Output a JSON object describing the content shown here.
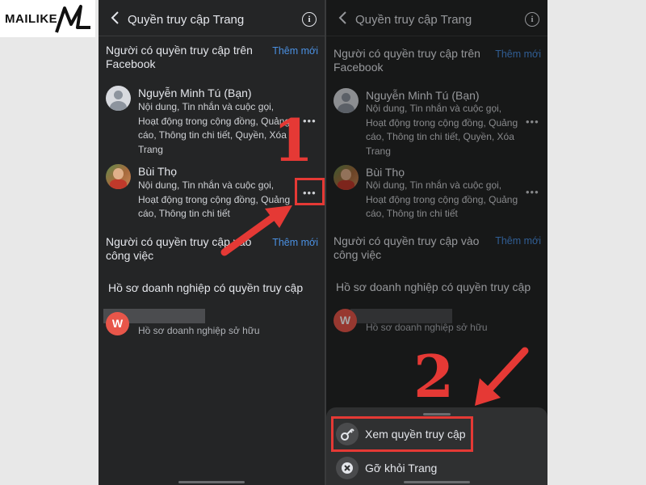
{
  "brand": {
    "text": "MAILIKE"
  },
  "left_screen": {
    "title": "Quyền truy cập Trang",
    "facebook_section": {
      "title": "Người có quyền truy cập trên Facebook",
      "add_label": "Thêm mới"
    },
    "people": [
      {
        "name": "Nguyễn Minh Tú (Bạn)",
        "permissions": "Nội dung, Tin nhắn và cuộc gọi, Hoạt động trong cộng đồng, Quảng cáo, Thông tin chi tiết, Quyền, Xóa Trang",
        "more": "•••"
      },
      {
        "name": "Bùi Thọ",
        "permissions": "Nội dung, Tin nhắn và cuộc gọi, Hoạt động trong cộng đồng, Quảng cáo, Thông tin chi tiết",
        "more": "•••"
      }
    ],
    "work_section": {
      "title": "Người có quyền truy cập vào công việc",
      "add_label": "Thêm mới"
    },
    "business_section": {
      "title": "Hồ sơ doanh nghiệp có quyền truy cập",
      "owner_label": "Hồ sơ doanh nghiệp sở hữu",
      "avatar_letter": "W"
    }
  },
  "right_screen": {
    "title": "Quyền truy cập Trang",
    "facebook_section": {
      "title": "Người có quyền truy cập trên Facebook",
      "add_label": "Thêm mới"
    },
    "people": [
      {
        "name": "Nguyễn Minh Tú (Bạn)",
        "permissions": "Nội dung, Tin nhắn và cuộc gọi, Hoạt động trong cộng đồng, Quảng cáo, Thông tin chi tiết, Quyền, Xóa Trang",
        "more": "•••"
      },
      {
        "name": "Bùi Thọ",
        "permissions": "Nội dung, Tin nhắn và cuộc gọi, Hoạt động trong cộng đồng, Quảng cáo, Thông tin chi tiết",
        "more": "•••"
      }
    ],
    "work_section": {
      "title": "Người có quyền truy cập vào công việc",
      "add_label": "Thêm mới"
    },
    "business_section": {
      "title": "Hồ sơ doanh nghiệp có quyền truy cập",
      "owner_label": "Hồ sơ doanh nghiệp sở hữu",
      "avatar_letter": "W"
    },
    "sheet": {
      "items": [
        {
          "label": "Xem quyền truy cập",
          "icon": "key-icon"
        },
        {
          "label": "Gỡ khỏi Trang",
          "icon": "close-circle-icon"
        }
      ]
    }
  },
  "annotations": {
    "step1": "1",
    "step2": "2",
    "highlight_color": "#e53935"
  }
}
